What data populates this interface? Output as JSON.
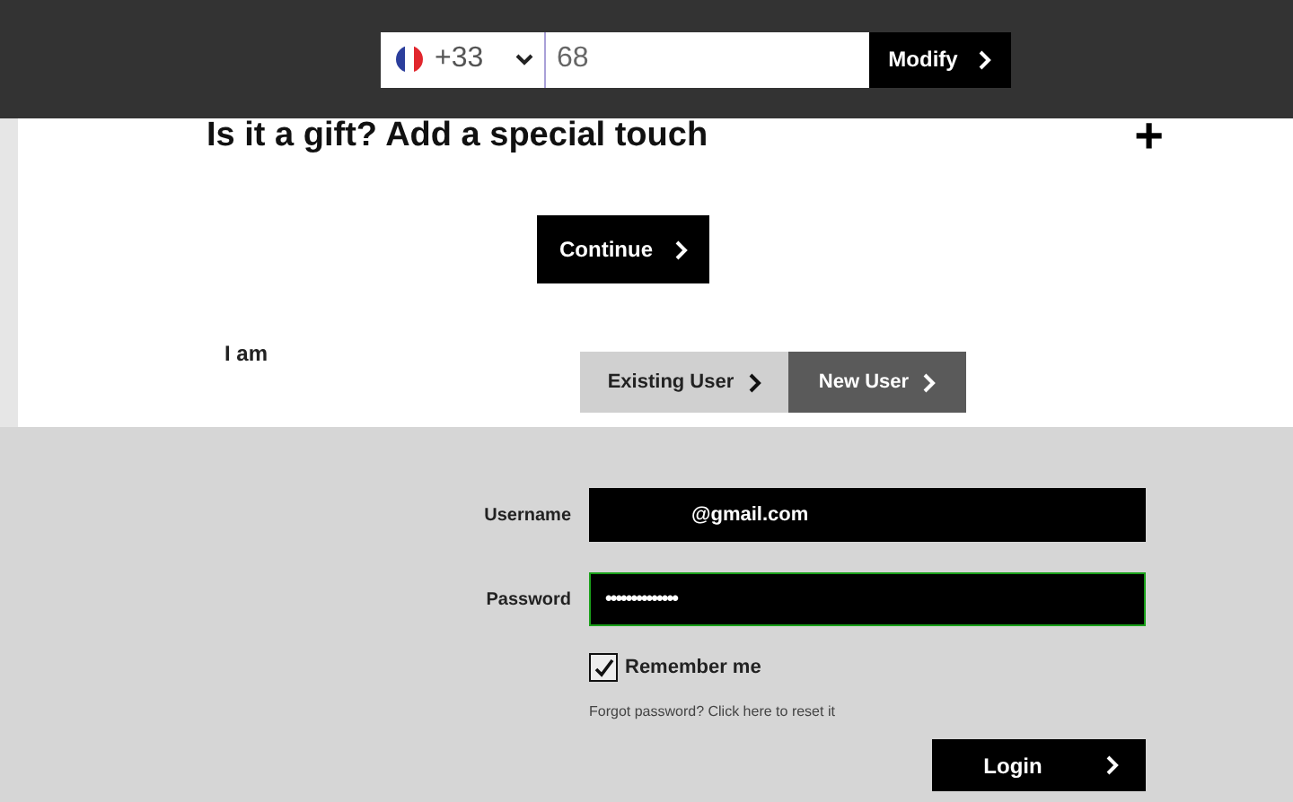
{
  "phone": {
    "country_code": "+33",
    "value": "68"
  },
  "modify_button": "Modify",
  "gift": {
    "title": "Is it a gift? Add a special touch",
    "toggle": "+",
    "expanded": false
  },
  "continue_button": "Continue",
  "user_type": {
    "label": "I am",
    "tabs": [
      {
        "label": "Existing User",
        "selected": true
      },
      {
        "label": "New User",
        "selected": false
      }
    ]
  },
  "login": {
    "username_label": "Username",
    "username_value": "@gmail.com",
    "password_label": "Password",
    "password_value": "••••••••••••••",
    "remember_label": "Remember me",
    "remember_checked": true,
    "forgot_link": "Forgot password? Click here to reset it",
    "login_button": "Login"
  }
}
